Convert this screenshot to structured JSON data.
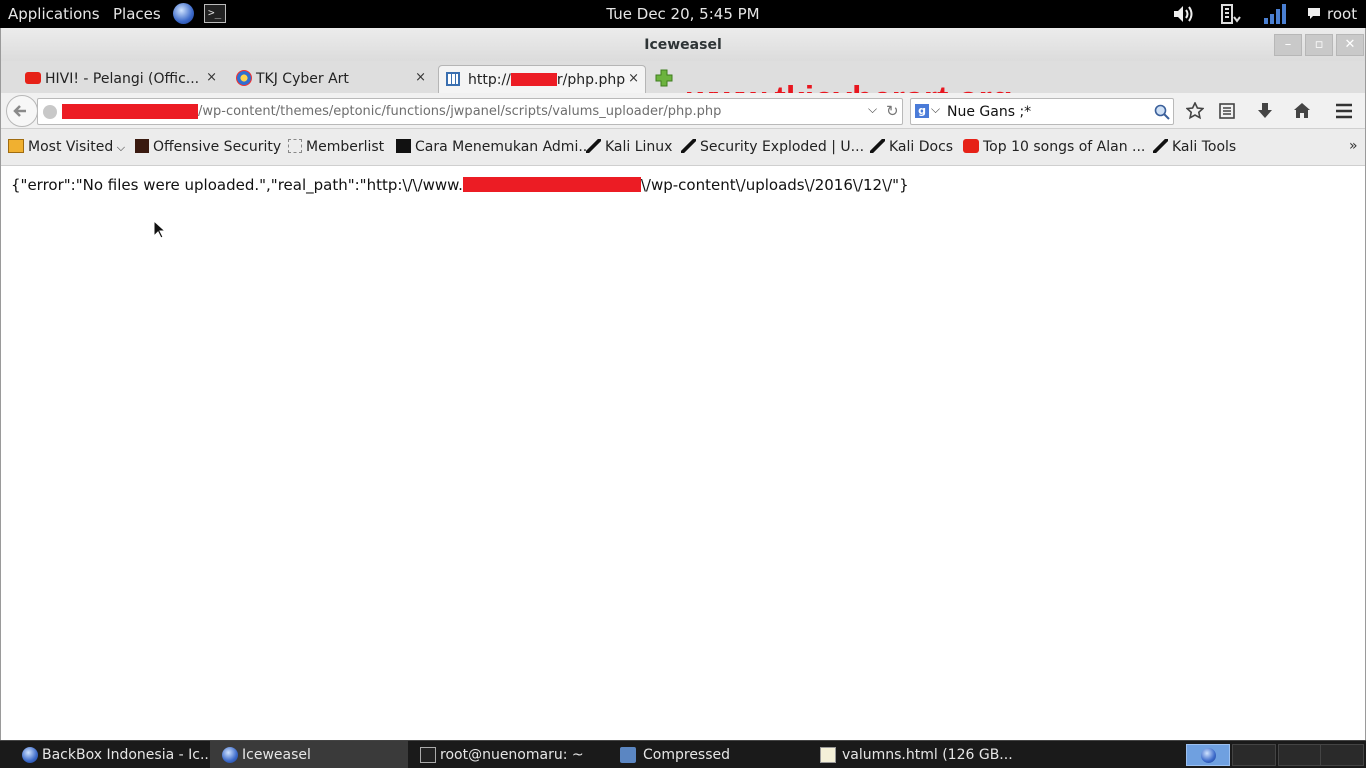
{
  "top_panel": {
    "applications": "Applications",
    "places": "Places",
    "clock": "Tue Dec 20,  5:45 PM",
    "user": "root"
  },
  "window": {
    "title": "Iceweasel"
  },
  "tabs": [
    {
      "title": "HIVI! - Pelangi (Offic...",
      "close": "×"
    },
    {
      "title": "TKJ Cyber Art",
      "close": "×"
    },
    {
      "title_prefix": "http://",
      "title_suffix": "r/php.php",
      "close": "×"
    }
  ],
  "watermark": "www.tkjcyberart.org",
  "urlbar": {
    "url": "/wp-content/themes/eptonic/functions/jwpanel/scripts/valums_uploader/php.php"
  },
  "searchbar": {
    "value": "Nue Gans ;*"
  },
  "bookmarks": [
    {
      "label": "Most Visited",
      "icon": "most-visited-icon"
    },
    {
      "label": "Offensive Security",
      "icon": "offsec-icon"
    },
    {
      "label": "Memberlist",
      "icon": "page-icon"
    },
    {
      "label": "Cara Menemukan Admi...",
      "icon": "terminal-icon"
    },
    {
      "label": "Kali Linux",
      "icon": "kali-icon"
    },
    {
      "label": "Security Exploded | U...",
      "icon": "kali-icon"
    },
    {
      "label": "Kali Docs",
      "icon": "kali-icon"
    },
    {
      "label": "Top 10 songs of Alan ...",
      "icon": "youtube-icon"
    },
    {
      "label": "Kali Tools",
      "icon": "kali-icon"
    }
  ],
  "page": {
    "json_prefix": "{\"error\":\"No files were uploaded.\",\"real_path\":\"http:\\/\\/www.",
    "json_suffix": "\\/wp-content\\/uploads\\/2016\\/12\\/\"}"
  },
  "taskbar": [
    {
      "label": "BackBox Indonesia - Ic...",
      "icon": "iceweasel-icon"
    },
    {
      "label": "Iceweasel",
      "icon": "iceweasel-icon"
    },
    {
      "label": "root@nuenomaru: ~",
      "icon": "terminal-icon"
    },
    {
      "label": "Compressed",
      "icon": "folder-icon"
    },
    {
      "label": "valumns.html (126 GB...",
      "icon": "text-editor-icon"
    }
  ],
  "colors": {
    "redaction": "#ec1c24",
    "watermark": "#e8161f"
  }
}
